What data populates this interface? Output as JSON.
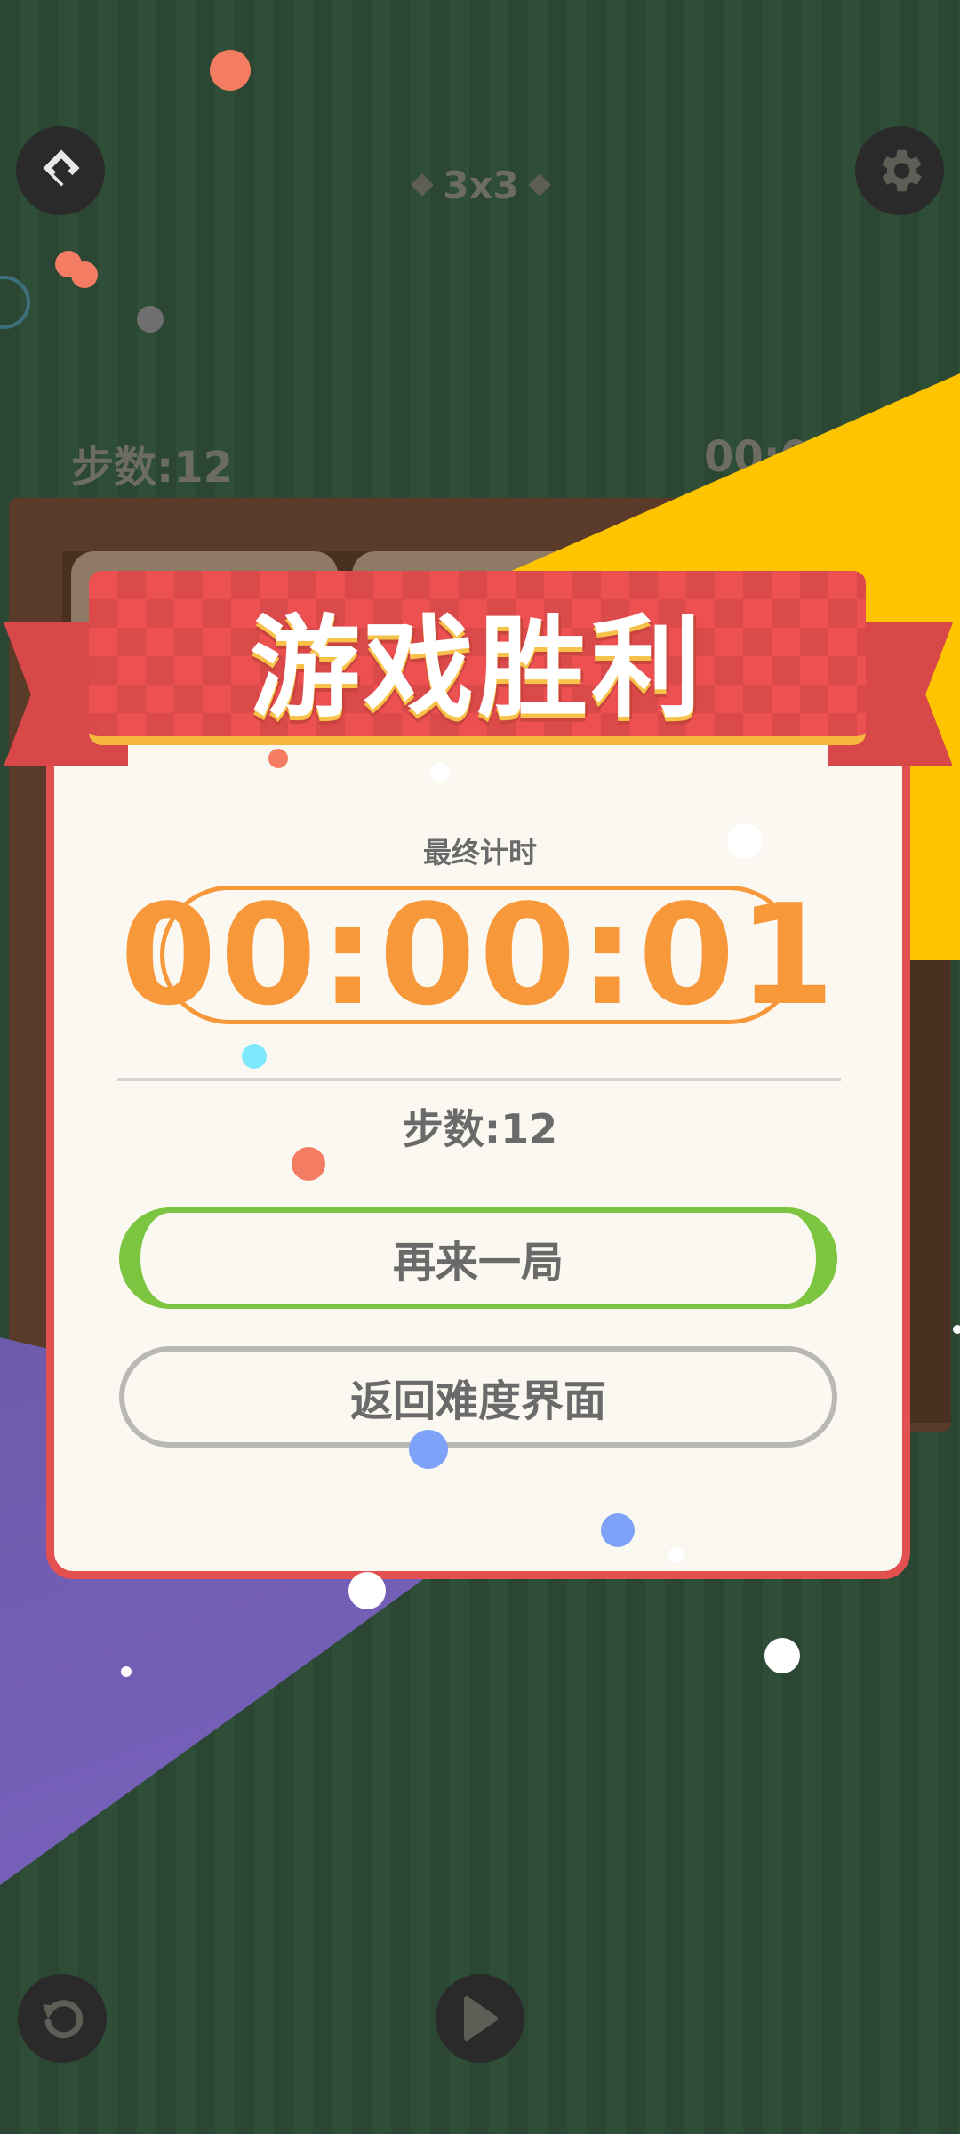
{
  "header": {
    "mode_label": "3x3"
  },
  "hud": {
    "steps": "步数:12",
    "time": "00:00"
  },
  "dialog": {
    "title": "游戏胜利",
    "final_time_label": "最终计时",
    "final_time": "00:00:01",
    "steps": "步数:12",
    "replay_button": "再来一局",
    "back_button": "返回难度界面"
  },
  "icons": [
    "back-icon",
    "settings-icon",
    "restart-icon",
    "play-icon"
  ],
  "colors": {
    "background": "#2c4a35",
    "ribbon": "#ec5050",
    "timer": "#f7983a",
    "replay_border": "#7cc540",
    "dialog_border": "#e2514f",
    "confetti_yellow": "#fec400",
    "confetti_purple": "#6b5aa8"
  }
}
